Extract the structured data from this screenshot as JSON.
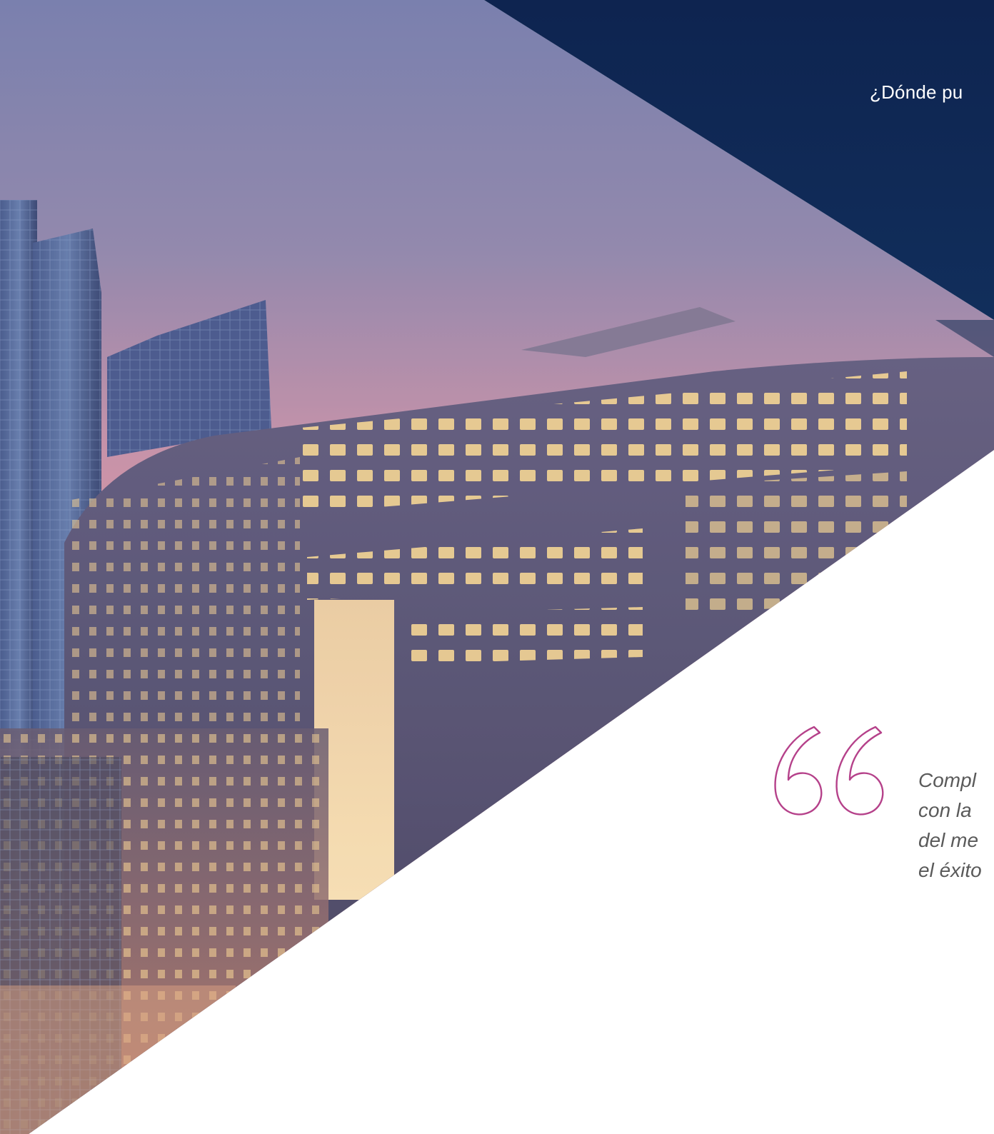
{
  "header": {
    "question": "¿Dónde pu"
  },
  "quote": {
    "icon": "quote-open-icon",
    "lines": [
      "Compl",
      "con la",
      "del me",
      "el éxito"
    ]
  },
  "colors": {
    "navy_top": "#0e2450",
    "navy_bottom": "#1b4a7a",
    "quote_accent": "#b5418a",
    "quote_text": "#5a5a5a",
    "sky_top": "#6e76aa",
    "sky_bottom": "#cf8aa0"
  }
}
